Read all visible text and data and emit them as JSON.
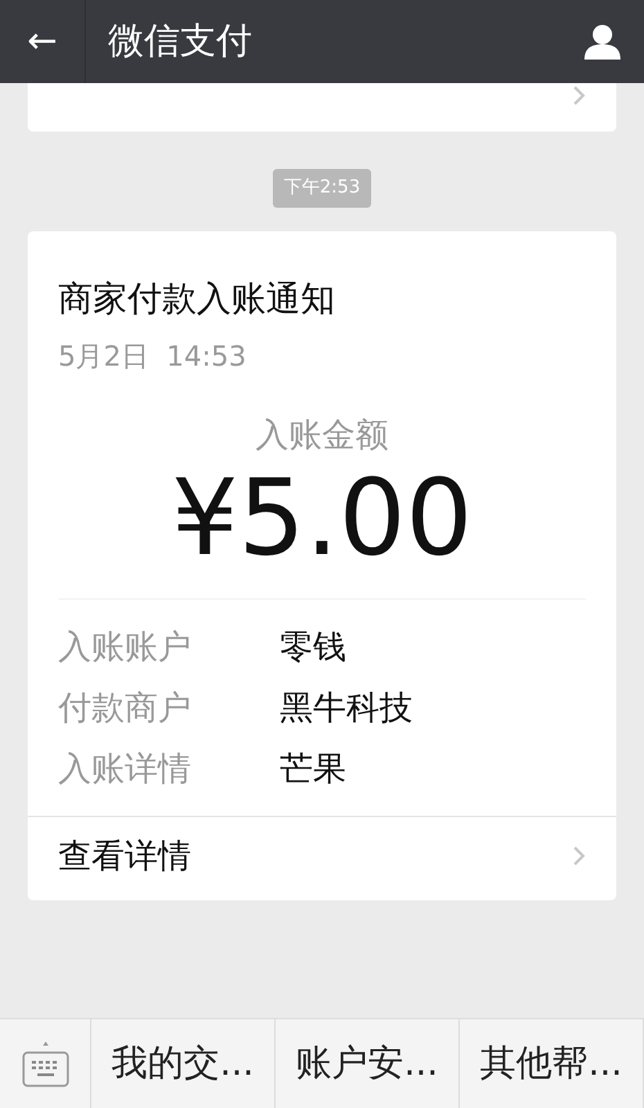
{
  "header": {
    "back": "←",
    "title": "微信支付"
  },
  "timestamp": "下午2:53",
  "card": {
    "title": "商家付款入账通知",
    "date": "5月2日  14:53",
    "amount_label": "入账金额",
    "amount": "¥5.00",
    "rows": [
      {
        "label": "入账账户",
        "value": "零钱"
      },
      {
        "label": "付款商户",
        "value": "黑牛科技"
      },
      {
        "label": "入账详情",
        "value": "芒果"
      }
    ],
    "link": "查看详情"
  },
  "menu": [
    "我的交...",
    "账户安...",
    "其他帮..."
  ]
}
